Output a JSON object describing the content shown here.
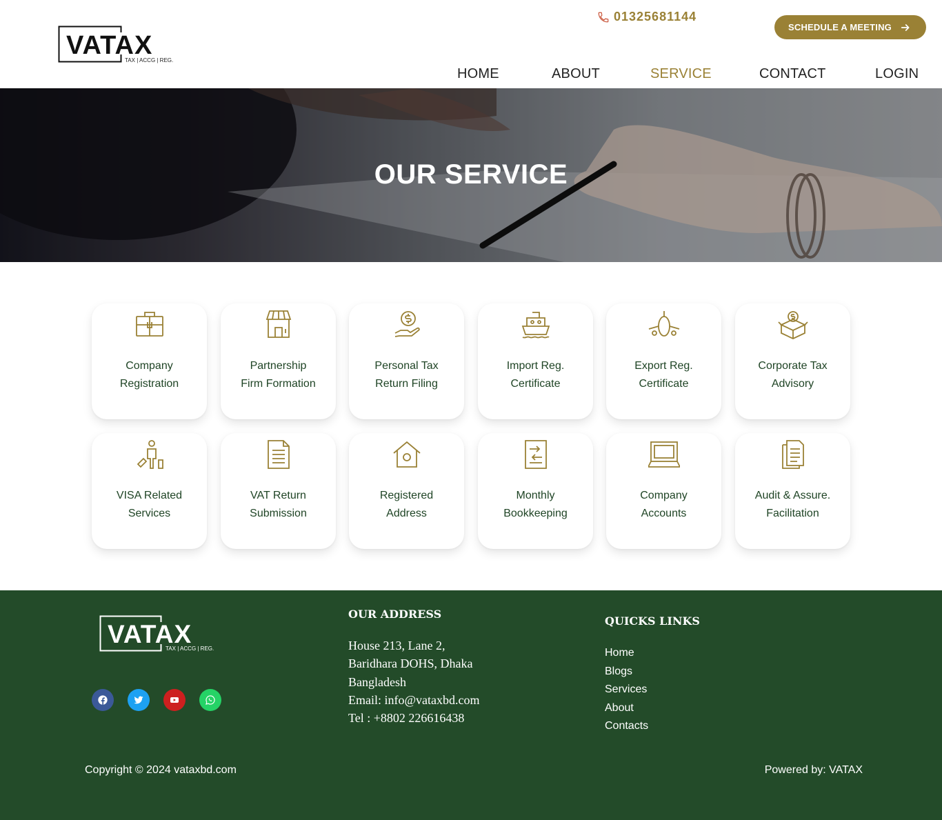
{
  "header": {
    "logo_text": "VATAX",
    "logo_tagline": "TAX | ACCG | REG.",
    "phone": "01325681144",
    "cta_label": "SCHEDULE A MEETING",
    "nav": [
      {
        "label": "HOME",
        "active": false
      },
      {
        "label": "ABOUT",
        "active": false
      },
      {
        "label": "SERVICE",
        "active": true
      },
      {
        "label": "CONTACT",
        "active": false
      },
      {
        "label": "LOGIN",
        "active": false
      }
    ]
  },
  "hero": {
    "title": "OUR SERVICE"
  },
  "services": [
    {
      "line1": "Company",
      "line2": "Registration",
      "icon": "briefcase-icon"
    },
    {
      "line1": "Partnership",
      "line2": "Firm Formation",
      "icon": "storefront-icon"
    },
    {
      "line1": "Personal  Tax",
      "line2": "Return Filing",
      "icon": "money-hand-icon"
    },
    {
      "line1": "Import Reg.",
      "line2": "Certificate",
      "icon": "ship-icon"
    },
    {
      "line1": "Export Reg.",
      "line2": "Certificate",
      "icon": "airplane-icon"
    },
    {
      "line1": "Corporate Tax",
      "line2": "Advisory",
      "icon": "money-box-icon"
    },
    {
      "line1": "VISA Related",
      "line2": "Services",
      "icon": "traveler-icon"
    },
    {
      "line1": "VAT Return",
      "line2": "Submission",
      "icon": "document-icon"
    },
    {
      "line1": "Registered",
      "line2": "Address",
      "icon": "house-icon"
    },
    {
      "line1": "Monthly",
      "line2": "Bookkeeping",
      "icon": "ledger-icon"
    },
    {
      "line1": "Company",
      "line2": "Accounts",
      "icon": "laptop-icon"
    },
    {
      "line1": "Audit & Assure.",
      "line2": "Facilitation",
      "icon": "report-icon"
    }
  ],
  "footer": {
    "logo_text": "VATAX",
    "logo_tagline": "TAX | ACCG | REG.",
    "address_heading": "OUR  ADDRESS",
    "address_lines": [
      "House 213, Lane 2,",
      "Baridhara DOHS, Dhaka",
      "Bangladesh",
      "Email:  info@vataxbd.com",
      "Tel : +8802 226616438"
    ],
    "links_heading": "QUICKS LINKS",
    "links": [
      "Home",
      "Blogs",
      "Services",
      "About",
      "Contacts"
    ],
    "copyright": "Copyright © 2024 vataxbd.com",
    "powered": "Powered by: VATAX",
    "socials": [
      {
        "name": "facebook",
        "color": "#3b5998"
      },
      {
        "name": "twitter",
        "color": "#1da1f2"
      },
      {
        "name": "youtube",
        "color": "#cd201f"
      },
      {
        "name": "whatsapp",
        "color": "#25d366"
      }
    ]
  },
  "colors": {
    "gold": "#9a8135",
    "green": "#234b29",
    "text_green": "#1f4425"
  }
}
